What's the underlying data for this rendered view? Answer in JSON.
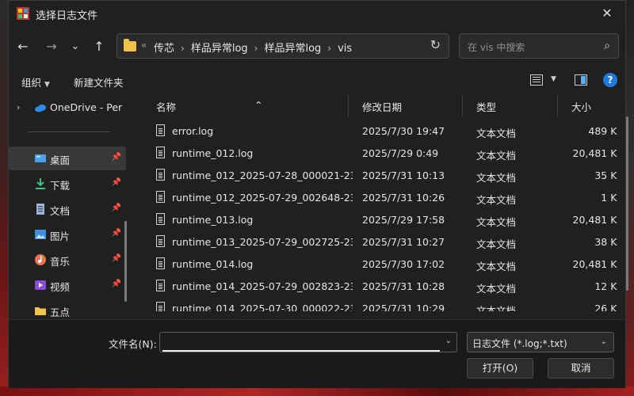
{
  "window": {
    "title": "选择日志文件",
    "close_glyph": "✕"
  },
  "nav": {
    "back": "←",
    "forward": "→",
    "recent": "⌄",
    "up": "↑"
  },
  "address": {
    "overflow": "«",
    "crumbs": [
      "传芯",
      "样品异常log",
      "样品异常log",
      "vis"
    ],
    "refresh": "↻"
  },
  "search": {
    "placeholder": "在 vis 中搜索",
    "icon": "⌕"
  },
  "toolbar": {
    "organize": "组织",
    "new_folder": "新建文件夹",
    "help": "?"
  },
  "sidebar": {
    "onedrive": "OneDrive - Per",
    "items": [
      {
        "label": "桌面",
        "icon": "desktop-icon"
      },
      {
        "label": "下载",
        "icon": "download-icon"
      },
      {
        "label": "文档",
        "icon": "document-icon"
      },
      {
        "label": "图片",
        "icon": "pictures-icon"
      },
      {
        "label": "音乐",
        "icon": "music-icon"
      },
      {
        "label": "视频",
        "icon": "video-icon"
      },
      {
        "label": "五点",
        "icon": "folder-icon"
      }
    ]
  },
  "columns": {
    "name": "名称",
    "date": "修改日期",
    "type": "类型",
    "size": "大小"
  },
  "files": [
    {
      "name": "error.log",
      "date": "2025/7/30 19:47",
      "type": "文本文档",
      "size": "489 KB"
    },
    {
      "name": "runtime_012.log",
      "date": "2025/7/29 0:49",
      "type": "文本文档",
      "size": "20,481 KB"
    },
    {
      "name": "runtime_012_2025-07-28_000021-235...",
      "date": "2025/7/31 10:13",
      "type": "文本文档",
      "size": "35 KB"
    },
    {
      "name": "runtime_012_2025-07-29_002648-232...",
      "date": "2025/7/31 10:26",
      "type": "文本文档",
      "size": "1 KB"
    },
    {
      "name": "runtime_013.log",
      "date": "2025/7/29 17:58",
      "type": "文本文档",
      "size": "20,481 KB"
    },
    {
      "name": "runtime_013_2025-07-29_002725-232...",
      "date": "2025/7/31 10:27",
      "type": "文本文档",
      "size": "38 KB"
    },
    {
      "name": "runtime_014.log",
      "date": "2025/7/30 17:02",
      "type": "文本文档",
      "size": "20,481 KB"
    },
    {
      "name": "runtime_014_2025-07-29_002823-232...",
      "date": "2025/7/31 10:28",
      "type": "文本文档",
      "size": "12 KB"
    },
    {
      "name": "runtime_014_2025-07-30_000022-232...",
      "date": "2025/7/31 10:29",
      "type": "文本文档",
      "size": "26 KB"
    }
  ],
  "bottom": {
    "filename_label": "文件名(N):",
    "filename_value": "",
    "filter": "日志文件 (*.log;*.txt)",
    "open": "打开(O)",
    "cancel": "取消"
  }
}
